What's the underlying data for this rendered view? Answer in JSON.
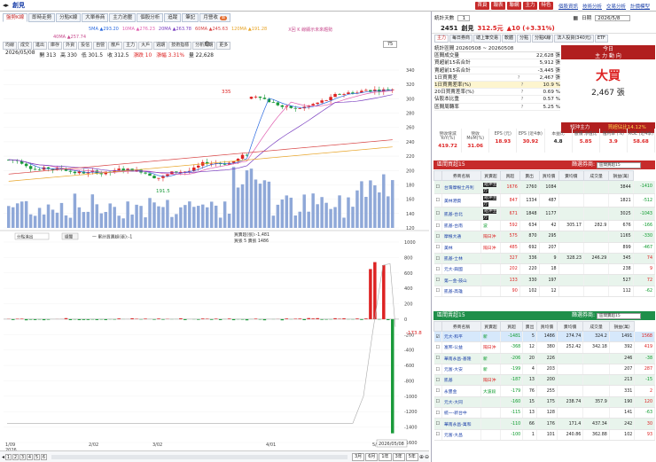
{
  "app": {
    "title": "創見",
    "topmenu_red": [
      "首頁",
      "報表",
      "聯網",
      "主力",
      "特色"
    ],
    "links": [
      "個股資訊",
      "技術分析",
      "交易分析",
      "計價模型"
    ]
  },
  "tabs": [
    "盤勢K線",
    "即時走勢",
    "分點K線",
    "大單券商",
    "主力池壓",
    "個股分析",
    "追蹤",
    "筆記",
    "月營收"
  ],
  "tab_pill": "新",
  "ma": [
    {
      "label": "5MA",
      "value": "293.20",
      "color": "#2b6ae0"
    },
    {
      "label": "10MA",
      "value": "276.23",
      "color": "#e05fb0"
    },
    {
      "label": "20MA",
      "value": "263.78",
      "color": "#7a3fc0"
    },
    {
      "label": "60MA",
      "value": "245.63",
      "color": "#d84444"
    },
    {
      "label": "120MA",
      "value": "191.28",
      "color": "#e8a427"
    }
  ],
  "ma240": {
    "label": "40MA",
    "value": "257.74",
    "color": "#c84b8e"
  },
  "reset_link": "X回 K 線顯示未來趨勢",
  "toolbar": [
    "均線",
    "成交",
    "進出",
    "庫存",
    "外資",
    "投信",
    "自營",
    "散戶",
    "主力",
    "大戶",
    "週期",
    "技術指標",
    "分析周期",
    "更多"
  ],
  "info": {
    "date": "2026/05/08",
    "open": "開 313",
    "high": "高 330",
    "low": "低 301.5",
    "close": "收 312.5",
    "change": "漲跌 10",
    "pct": "漲幅 3.31%",
    "vol": "量 22,628"
  },
  "zoom": "75",
  "price_axis": [
    "340",
    "320",
    "300",
    "280",
    "260",
    "240",
    "220",
    "200",
    "180",
    "160",
    "140",
    "120"
  ],
  "peak_label": "335",
  "trough_label": "191.5",
  "sub_axis": [
    "1000",
    "800",
    "600",
    "400",
    "200",
    "0",
    "-200",
    "-400",
    "-600",
    "-800",
    "-1000",
    "-1200",
    "-1400",
    "-1600"
  ],
  "sub_label": "-173.8",
  "sub_legend": "一 累計買賣超(張):-1",
  "sub_legend2": "買賣超(張):-1,481",
  "sub_legend3": "買張 5 賣張 1486",
  "sub_select": "分點進出",
  "sub_btn": "總覽",
  "x_axis": [
    "1/09",
    "2/02",
    "3/02",
    "4/01",
    "5/04"
  ],
  "x_year": "2026",
  "x_end": "2026/05/08",
  "pages": [
    "1",
    "2",
    "3",
    "4",
    "5",
    "6"
  ],
  "ranges": [
    "3月",
    "6月",
    "1年",
    "3年",
    "5年"
  ],
  "right": {
    "days_label": "統計天數",
    "days_value": "1",
    "date_label": "日期",
    "date_value": "2026/5/8",
    "code": "2451",
    "name": "創見",
    "price": "312.5元",
    "change": "▲10 (+3.31%)",
    "subtabs": [
      "主力",
      "每日券商",
      "總上筆交易",
      "軟體",
      "分點",
      "分點K線",
      "法人投資(340元)",
      "ETF"
    ],
    "range": "統計區間 20260508 ~ 20260508",
    "stats": [
      [
        "區間成交量",
        "",
        "22,628 張"
      ],
      [
        "買超前15名合計",
        "",
        "5,912 張"
      ],
      [
        "賣超前15名合計",
        "",
        "-3,445 張"
      ],
      [
        "1日買賣差",
        "?",
        "2,467 張"
      ],
      [
        "1日買賣差率(%)",
        "?",
        "10.9 %"
      ],
      [
        "20日買賣差率(%)",
        "?",
        "0.69 %"
      ],
      [
        "佔股本比重",
        "?",
        "0.57 %"
      ],
      [
        "區間周轉率",
        "?",
        "5.25 %"
      ]
    ],
    "today": {
      "h1": "今日",
      "h2": "主 力 動 向",
      "verdict": "大買",
      "value": "2,467 張",
      "foot1": "短沖主力",
      "foot2": "買超佔比14.12%"
    },
    "metrics": [
      {
        "k": "營收增減 YoY(%)",
        "v": "419.72"
      },
      {
        "k": "營收 MoM(%)",
        "v": "31.06"
      },
      {
        "k": "EPS (元)",
        "v": "18.93"
      },
      {
        "k": "EPS (近4季)",
        "v": "30.92"
      },
      {
        "k": "本益比",
        "v": "4.8"
      },
      {
        "k": "股價 淨值比",
        "v": "5.85"
      },
      {
        "k": "殖利率 (%)",
        "v": "3.9"
      },
      {
        "k": "ROE (近4季)",
        "v": "58.68"
      }
    ],
    "buy_title": "區間買超15",
    "sell_title": "區間賣超15",
    "filter_label": "篩選券商:",
    "filter_value": "區間買超15",
    "sell_filter_value": "區間賣超15",
    "cols": [
      "",
      "券商名稱",
      "買賣超",
      "買超",
      "賣出",
      "買均價",
      "賣均價",
      "成交量",
      "損益(萬)"
    ],
    "buy_rows": [
      [
        "台灣摩根士丹利",
        "短沖主力",
        "1676",
        "2760",
        "1084",
        "",
        "",
        "3844",
        "-1410"
      ],
      [
        "美林港資",
        "短沖主力",
        "847",
        "1334",
        "487",
        "",
        "",
        "1821",
        "-512"
      ],
      [
        "凱基-台北",
        "短沖主力",
        "671",
        "1848",
        "1177",
        "",
        "",
        "3025",
        "-1043"
      ],
      [
        "凱基-台南",
        "波",
        "592",
        "634",
        "42",
        "305.17",
        "282.9",
        "676",
        "-166"
      ],
      [
        "摩根大通",
        "隔日沖",
        "575",
        "870",
        "295",
        "",
        "",
        "1165",
        "-330"
      ],
      [
        "美林",
        "隔日沖",
        "485",
        "692",
        "207",
        "",
        "",
        "899",
        "-467"
      ],
      [
        "凱基-士林",
        "",
        "327",
        "336",
        "9",
        "328.23",
        "246.29",
        "345",
        "74"
      ],
      [
        "元大-興國",
        "",
        "202",
        "220",
        "18",
        "",
        "",
        "238",
        "9"
      ],
      [
        "第一金-鼓山",
        "",
        "133",
        "330",
        "197",
        "",
        "",
        "527",
        "72"
      ],
      [
        "凱基-高雄",
        "",
        "90",
        "102",
        "12",
        "",
        "",
        "112",
        "-62"
      ]
    ],
    "buy_tags": [
      "大波段",
      "大波段",
      "大波段",
      "",
      "",
      "",
      "",
      "",
      "",
      ""
    ],
    "sell_rows": [
      [
        "元大-和平",
        "新",
        "-1481",
        "5",
        "1486",
        "274.74",
        "324.2",
        "1491",
        "1568"
      ],
      [
        "富邦-公益",
        "隔日沖",
        "-368",
        "12",
        "380",
        "252.42",
        "342.18",
        "392",
        "419"
      ],
      [
        "華南永昌-基隆",
        "新",
        "-206",
        "20",
        "226",
        "",
        "",
        "246",
        "-38"
      ],
      [
        "元富-大安",
        "新",
        "-199",
        "4",
        "203",
        "",
        "",
        "207",
        "287"
      ],
      [
        "凱基",
        "隔日沖",
        "-187",
        "13",
        "200",
        "",
        "",
        "213",
        "-15"
      ],
      [
        "永豐金",
        "大波段",
        "-179",
        "76",
        "255",
        "",
        "",
        "331",
        "2"
      ],
      [
        "元大-大同",
        "",
        "-160",
        "15",
        "175",
        "238.74",
        "357.9",
        "190",
        "120"
      ],
      [
        "統一-新台中",
        "",
        "-115",
        "13",
        "128",
        "",
        "",
        "141",
        "-63"
      ],
      [
        "華南永昌-萬和",
        "",
        "-110",
        "66",
        "176",
        "171.4",
        "437.34",
        "242",
        "30"
      ],
      [
        "元富-大昌",
        "",
        "-100",
        "1",
        "101",
        "240.86",
        "362.88",
        "102",
        "93"
      ]
    ]
  }
}
